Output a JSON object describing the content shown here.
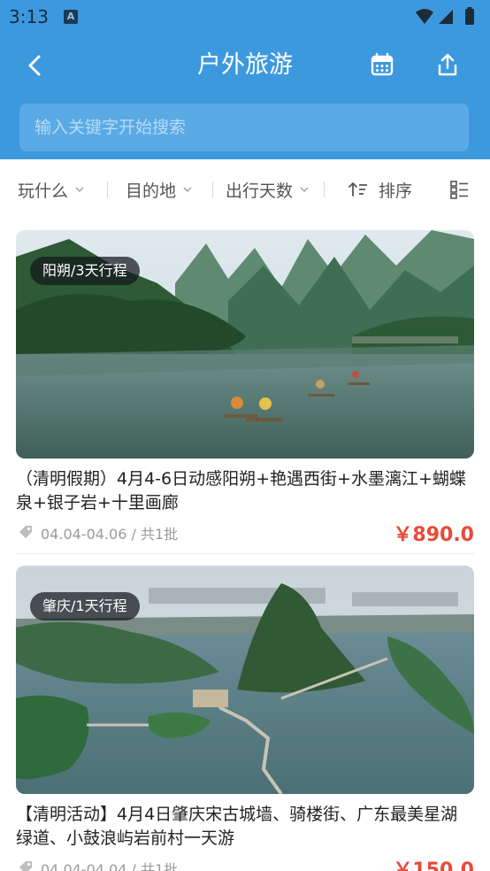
{
  "status_bar": {
    "time": "3:13",
    "notification_letter": "A"
  },
  "header": {
    "title": "户外旅游",
    "search_placeholder": "输入关键字开始搜索"
  },
  "filters": {
    "play": "玩什么",
    "destination": "目的地",
    "days": "出行天数",
    "sort": "排序"
  },
  "colors": {
    "primary": "#3d99de",
    "price": "#e84a3a"
  },
  "trips": [
    {
      "badge": "阳朔/3天行程",
      "title": "（清明假期）4月4-6日动感阳朔+艳遇西街+水墨漓江+蝴蝶泉+银子岩+十里画廊",
      "meta": "04.04-04.06 / 共1批",
      "price": "￥890.0"
    },
    {
      "badge": "肇庆/1天行程",
      "title": "【清明活动】4月4日肇庆宋古城墙、骑楼街、广东最美星湖绿道、小鼓浪屿岩前村一天游",
      "meta": "04.04-04.04 / 共1批",
      "price": "￥150.0"
    }
  ]
}
